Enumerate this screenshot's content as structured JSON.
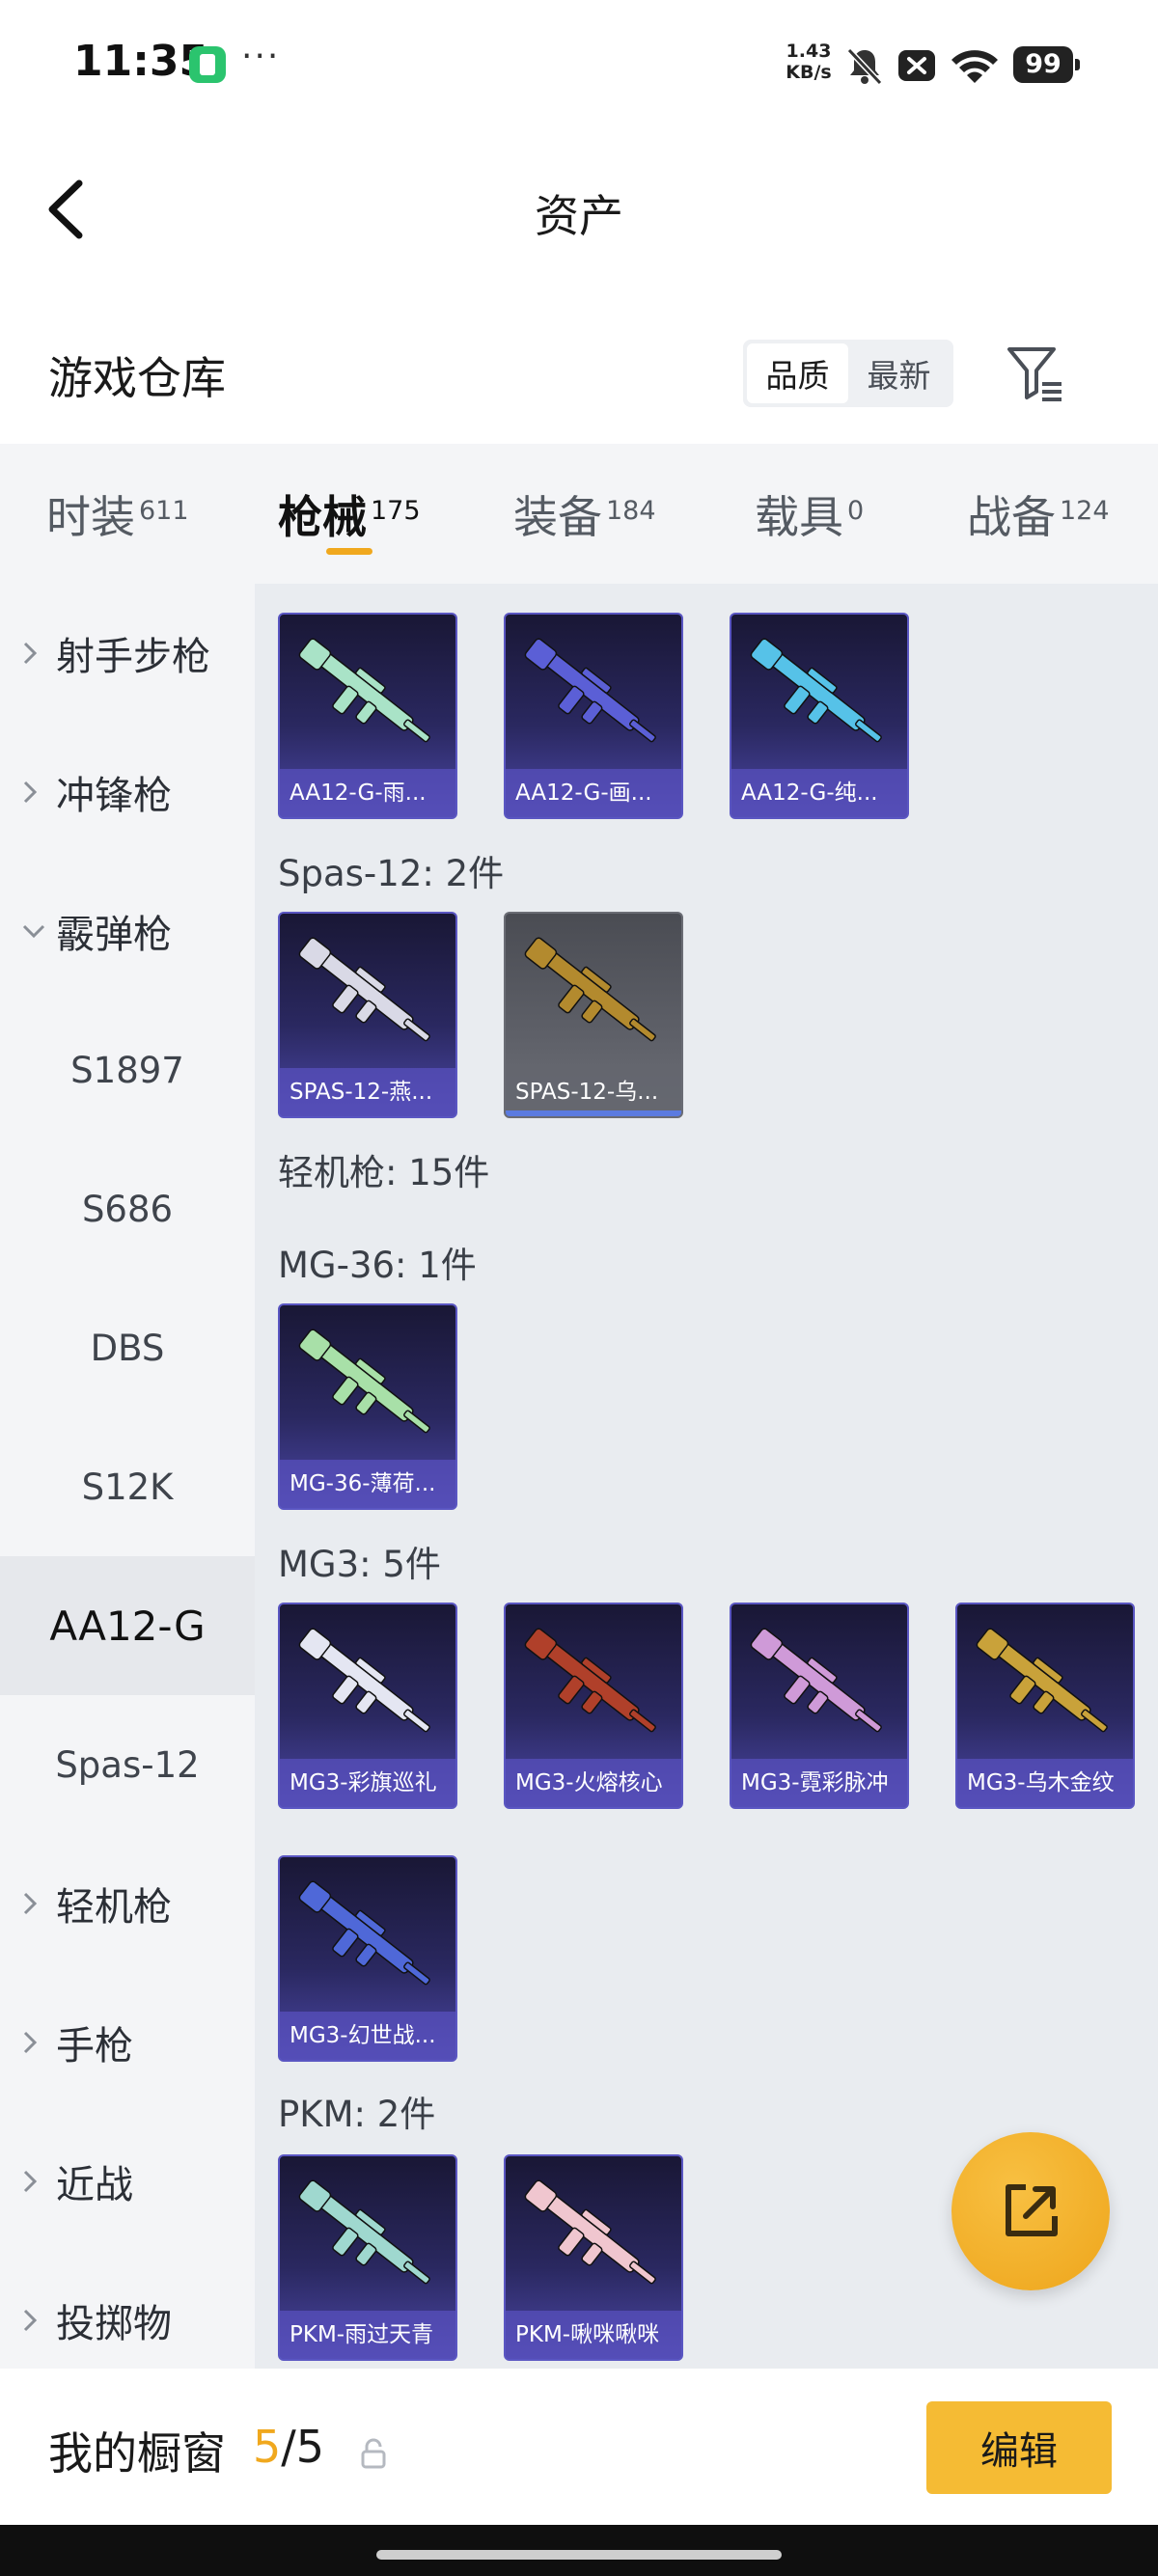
{
  "status_bar": {
    "time": "11:35",
    "net_speed_value": "1.43",
    "net_speed_unit": "KB/s",
    "battery": "99"
  },
  "nav": {
    "title": "资产"
  },
  "warehouse": {
    "title": "游戏仓库",
    "sort_options": [
      "品质",
      "最新"
    ],
    "active_sort": "品质"
  },
  "tabs": [
    {
      "label": "时装",
      "count": "611"
    },
    {
      "label": "枪械",
      "count": "175"
    },
    {
      "label": "装备",
      "count": "184"
    },
    {
      "label": "载具",
      "count": "0"
    },
    {
      "label": "战备",
      "count": "124"
    }
  ],
  "active_tab": "枪械",
  "sidebar": {
    "items": [
      {
        "label": "射手步枪"
      },
      {
        "label": "冲锋枪"
      },
      {
        "label": "霰弹枪"
      },
      {
        "label": "S1897"
      },
      {
        "label": "S686"
      },
      {
        "label": "DBS"
      },
      {
        "label": "S12K"
      },
      {
        "label": "AA12-G"
      },
      {
        "label": "Spas-12"
      },
      {
        "label": "轻机枪"
      },
      {
        "label": "手枪"
      },
      {
        "label": "近战"
      },
      {
        "label": "投掷物"
      }
    ],
    "selected": "AA12-G"
  },
  "content": {
    "groups": [
      {
        "title": "Spas-12: 2件"
      },
      {
        "title": "轻机枪: 15件"
      },
      {
        "title": "MG-36: 1件"
      },
      {
        "title": "MG3: 5件"
      },
      {
        "title": "PKM: 2件"
      }
    ],
    "cards": [
      {
        "label": "AA12-G-雨...",
        "gun_color": "#a9e3c7"
      },
      {
        "label": "AA12-G-画...",
        "gun_color": "#5b5fd6"
      },
      {
        "label": "AA12-G-纯...",
        "gun_color": "#56c2e8"
      },
      {
        "label": "SPAS-12-燕...",
        "gun_color": "#d9d9e6"
      },
      {
        "label": "SPAS-12-乌...",
        "gun_color": "#b38a2e"
      },
      {
        "label": "MG-36-薄荷...",
        "gun_color": "#a8e0a8"
      },
      {
        "label": "MG3-彩旗巡礼",
        "gun_color": "#e4e6f2"
      },
      {
        "label": "MG3-火熔核心",
        "gun_color": "#b0402a"
      },
      {
        "label": "MG3-霓彩脉冲",
        "gun_color": "#cf9ad8"
      },
      {
        "label": "MG3-乌木金纹",
        "gun_color": "#c9a23a"
      },
      {
        "label": "MG3-幻世战...",
        "gun_color": "#4f68d8"
      },
      {
        "label": "PKM-雨过天青",
        "gun_color": "#9fd8cf"
      },
      {
        "label": "PKM-啾咪啾咪",
        "gun_color": "#f0c6cf"
      }
    ]
  },
  "showcase": {
    "label": "我的橱窗",
    "current": "5",
    "separator": "/",
    "total": "5",
    "edit_label": "编辑"
  }
}
